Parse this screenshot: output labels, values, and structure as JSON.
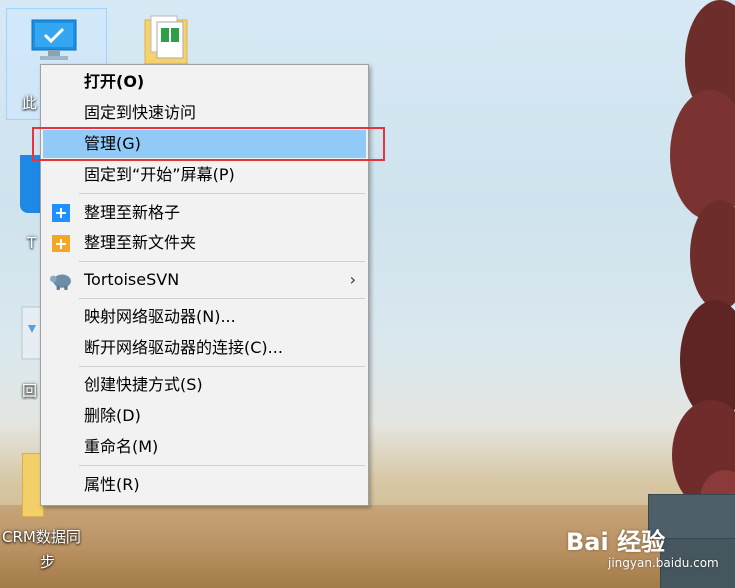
{
  "desktop": {
    "icons": [
      {
        "label": "此"
      },
      {
        "label": ""
      },
      {
        "label": "T"
      },
      {
        "label": "回"
      },
      {
        "label": "CRM数据同"
      },
      {
        "label": "步"
      }
    ]
  },
  "context_menu": {
    "items": [
      {
        "label": "打开(O)",
        "bold": true
      },
      {
        "label": "固定到快速访问"
      },
      {
        "label": "管理(G)",
        "highlighted": true
      },
      {
        "label": "固定到“开始”屏幕(P)"
      },
      {
        "label": "整理至新格子",
        "icon": "plus-blue-icon"
      },
      {
        "label": "整理至新文件夹",
        "icon": "plus-folder-icon"
      },
      {
        "label": "TortoiseSVN",
        "icon": "tortoise-icon",
        "submenu": true,
        "arrow": "›"
      },
      {
        "label": "映射网络驱动器(N)..."
      },
      {
        "label": "断开网络驱动器的连接(C)..."
      },
      {
        "label": "创建快捷方式(S)"
      },
      {
        "label": "删除(D)"
      },
      {
        "label": "重命名(M)"
      },
      {
        "label": "属性(R)"
      }
    ]
  },
  "watermark": {
    "brand": "Bai 经验",
    "sub": "jingyan.baidu.com"
  },
  "colors": {
    "highlight": "#91c9f7",
    "annotation": "#e8333a",
    "menu_bg": "#f2f2f2"
  }
}
